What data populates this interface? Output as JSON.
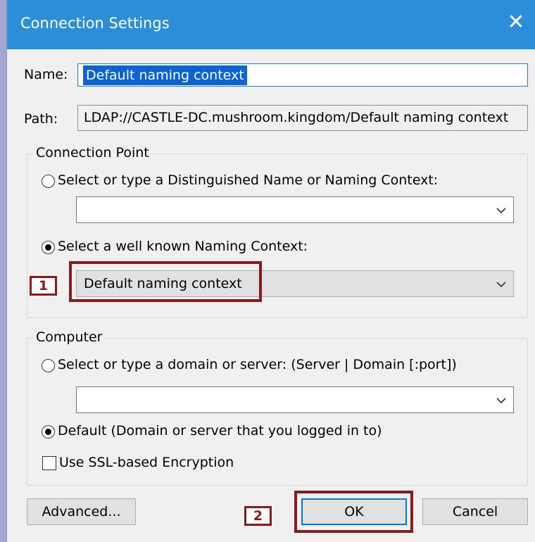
{
  "window": {
    "title": "Connection Settings",
    "close_glyph": "✕"
  },
  "name_field": {
    "label": "Name:",
    "value": "Default naming context"
  },
  "path_field": {
    "label": "Path:",
    "value": "LDAP://CASTLE-DC.mushroom.kingdom/Default naming context"
  },
  "connection_point": {
    "title": "Connection Point",
    "option_dn_label": "Select or type a Distinguished Name or Naming Context:",
    "option_dn_selected": false,
    "dn_combo_value": "",
    "option_wellknown_label": "Select a well known Naming Context:",
    "option_wellknown_selected": true,
    "wellknown_combo_value": "Default naming context"
  },
  "computer": {
    "title": "Computer",
    "option_server_label": "Select or type a domain or server: (Server | Domain [:port])",
    "option_server_selected": false,
    "server_combo_value": "",
    "option_default_label": "Default (Domain or server that you logged in to)",
    "option_default_selected": true,
    "ssl_label": "Use SSL-based Encryption",
    "ssl_checked": false
  },
  "buttons": {
    "advanced": "Advanced...",
    "ok": "OK",
    "cancel": "Cancel"
  },
  "callouts": {
    "one": "1",
    "two": "2"
  },
  "colors": {
    "titlebar": "#2b8ed9",
    "callout": "#8b1a1a",
    "selection": "#0a64d3"
  },
  "icons": {
    "close": "close-icon",
    "dropdown": "chevron-down-icon"
  }
}
